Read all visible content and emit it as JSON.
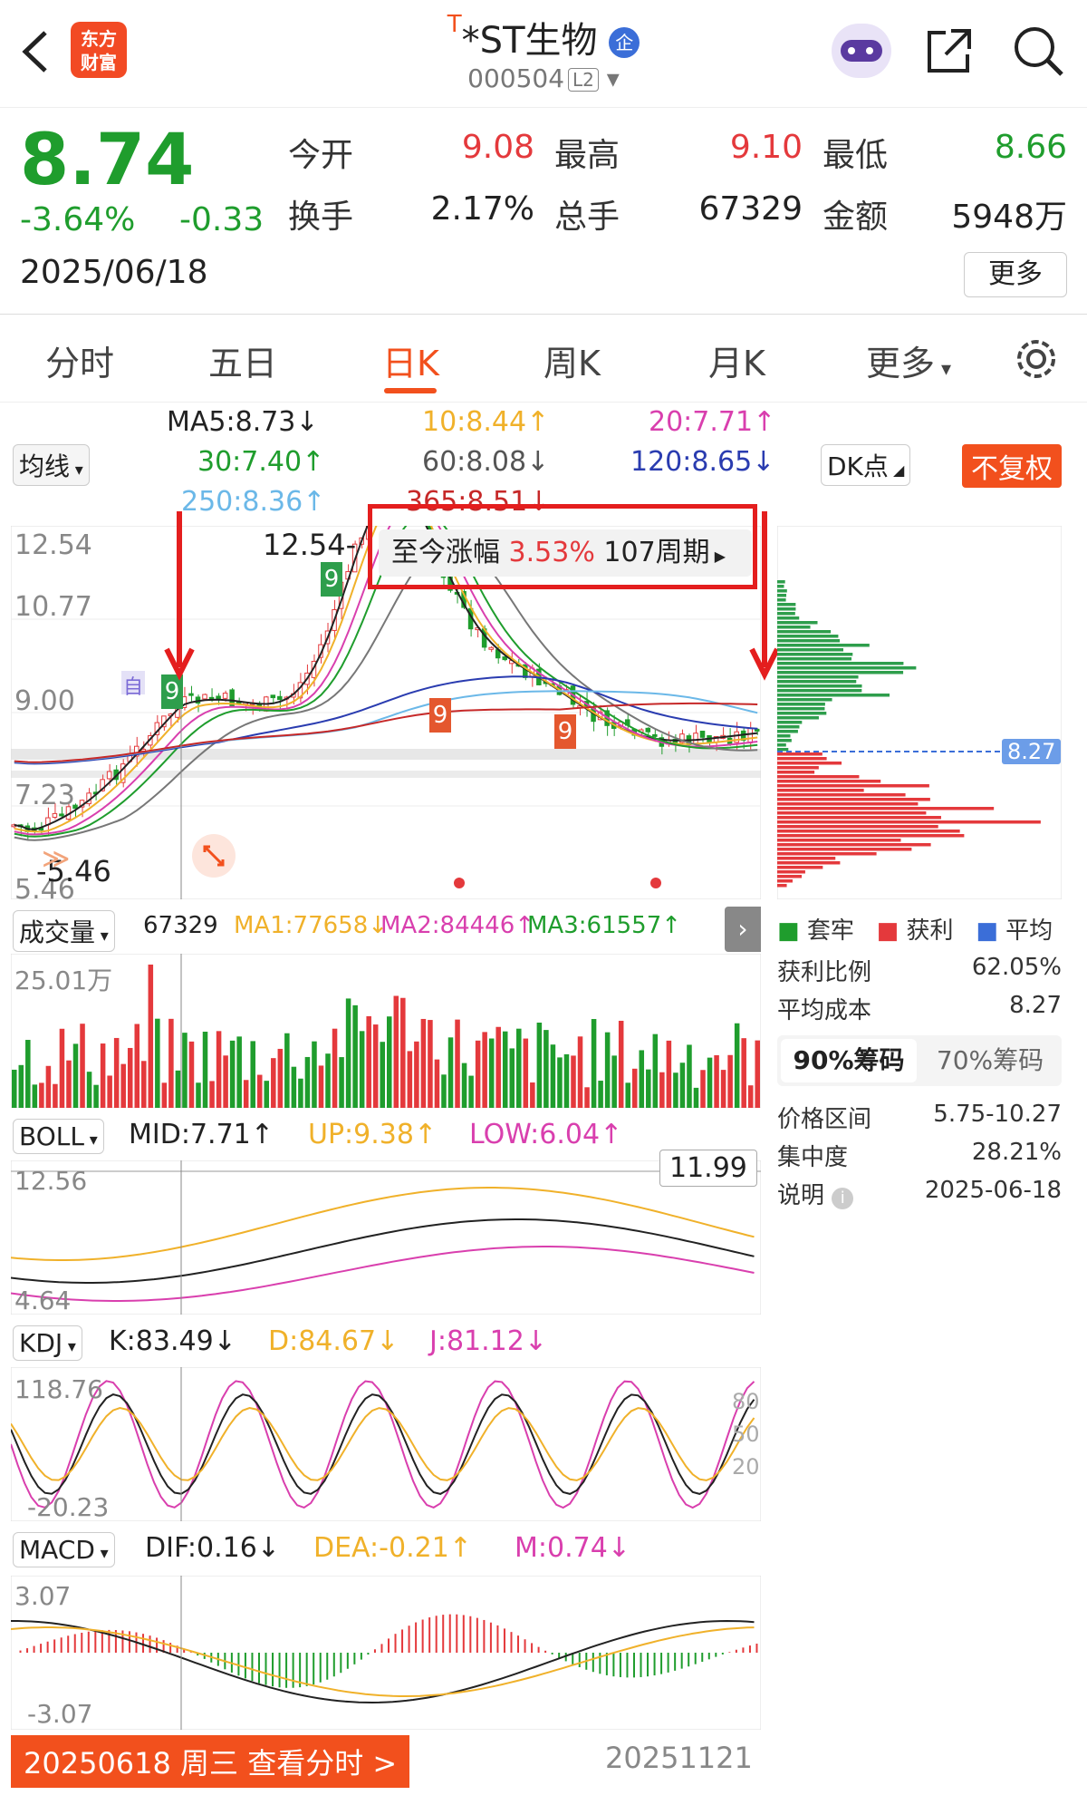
{
  "header": {
    "logo_line1": "东方",
    "logo_line2": "财富",
    "stock_tag": "T",
    "stock_name": "*ST生物",
    "badge": "企",
    "code": "000504",
    "level": "L2"
  },
  "quote": {
    "price": "8.74",
    "change_pct": "-3.64%",
    "change": "-0.33",
    "date": "2025/06/18",
    "open_label": "今开",
    "open": "9.08",
    "high_label": "最高",
    "high": "9.10",
    "low_label": "最低",
    "low": "8.66",
    "turnover_label": "换手",
    "turnover": "2.17%",
    "volume_label": "总手",
    "volume": "67329",
    "amount_label": "金额",
    "amount": "5948万",
    "more": "更多"
  },
  "tabs": [
    "分时",
    "五日",
    "日K",
    "周K",
    "月K",
    "更多"
  ],
  "ma_bar": {
    "selector": "均线",
    "ma5": "MA5:8.73↓",
    "ma10": "10:8.44↑",
    "ma20": "20:7.71↑",
    "ma30": "30:7.40↑",
    "ma60": "60:8.08↓",
    "ma120": "120:8.65↓",
    "ma250": "250:8.36↑",
    "ma365": "365:8.51↓",
    "dk": "DK点",
    "fq": "不复权"
  },
  "kline": {
    "ymax": "12.54",
    "y2": "10.77",
    "y3": "9.00",
    "y4": "7.23",
    "ymin": "5.46",
    "peak_label": "12.54",
    "low_label": "5.46",
    "range_label": "至今涨幅",
    "range_pct": "3.53%",
    "range_period": "107周期",
    "self_tag": "自",
    "signal_nine": "9"
  },
  "chips": {
    "price_marker": "8.27",
    "legend": [
      "套牢",
      "获利",
      "平均"
    ],
    "profit_ratio_label": "获利比例",
    "profit_ratio": "62.05%",
    "avg_cost_label": "平均成本",
    "avg_cost": "8.27",
    "tab90": "90%筹码",
    "tab70": "70%筹码",
    "range_label": "价格区间",
    "range": "5.75-10.27",
    "conc_label": "集中度",
    "conc": "28.21%",
    "note_label": "说明",
    "note_date": "2025-06-18"
  },
  "volume": {
    "selector": "成交量",
    "value": "67329",
    "ma1": "MA1:77658↓",
    "ma2": "MA2:84446↑",
    "ma3": "MA3:61557↑",
    "ymax": "25.01万"
  },
  "boll": {
    "selector": "BOLL",
    "mid": "MID:7.71↑",
    "up": "UP:9.38↑",
    "low": "LOW:6.04↑",
    "ymax": "12.56",
    "ymin": "4.64",
    "crosshair": "11.99"
  },
  "kdj": {
    "selector": "KDJ",
    "k": "K:83.49↓",
    "d": "D:84.67↓",
    "j": "J:81.12↓",
    "ymax": "118.76",
    "ymin": "-20.23",
    "l80": "80",
    "l50": "50",
    "l20": "20"
  },
  "macd": {
    "selector": "MACD",
    "dif": "DIF:0.16↓",
    "dea": "DEA:-0.21↑",
    "m": "M:0.74↓",
    "ymax": "3.07",
    "ymin": "-3.07"
  },
  "footer": {
    "date_btn": "20250618 周三 查看分时 >",
    "end_date": "20251121"
  },
  "colors": {
    "up": "#e4393c",
    "down": "#1f9d2d",
    "accent": "#f2501d",
    "ma10": "#f0b12a",
    "ma20": "#d93fae",
    "ma120": "#2a3cb0",
    "ma250": "#6bb8e8"
  }
}
